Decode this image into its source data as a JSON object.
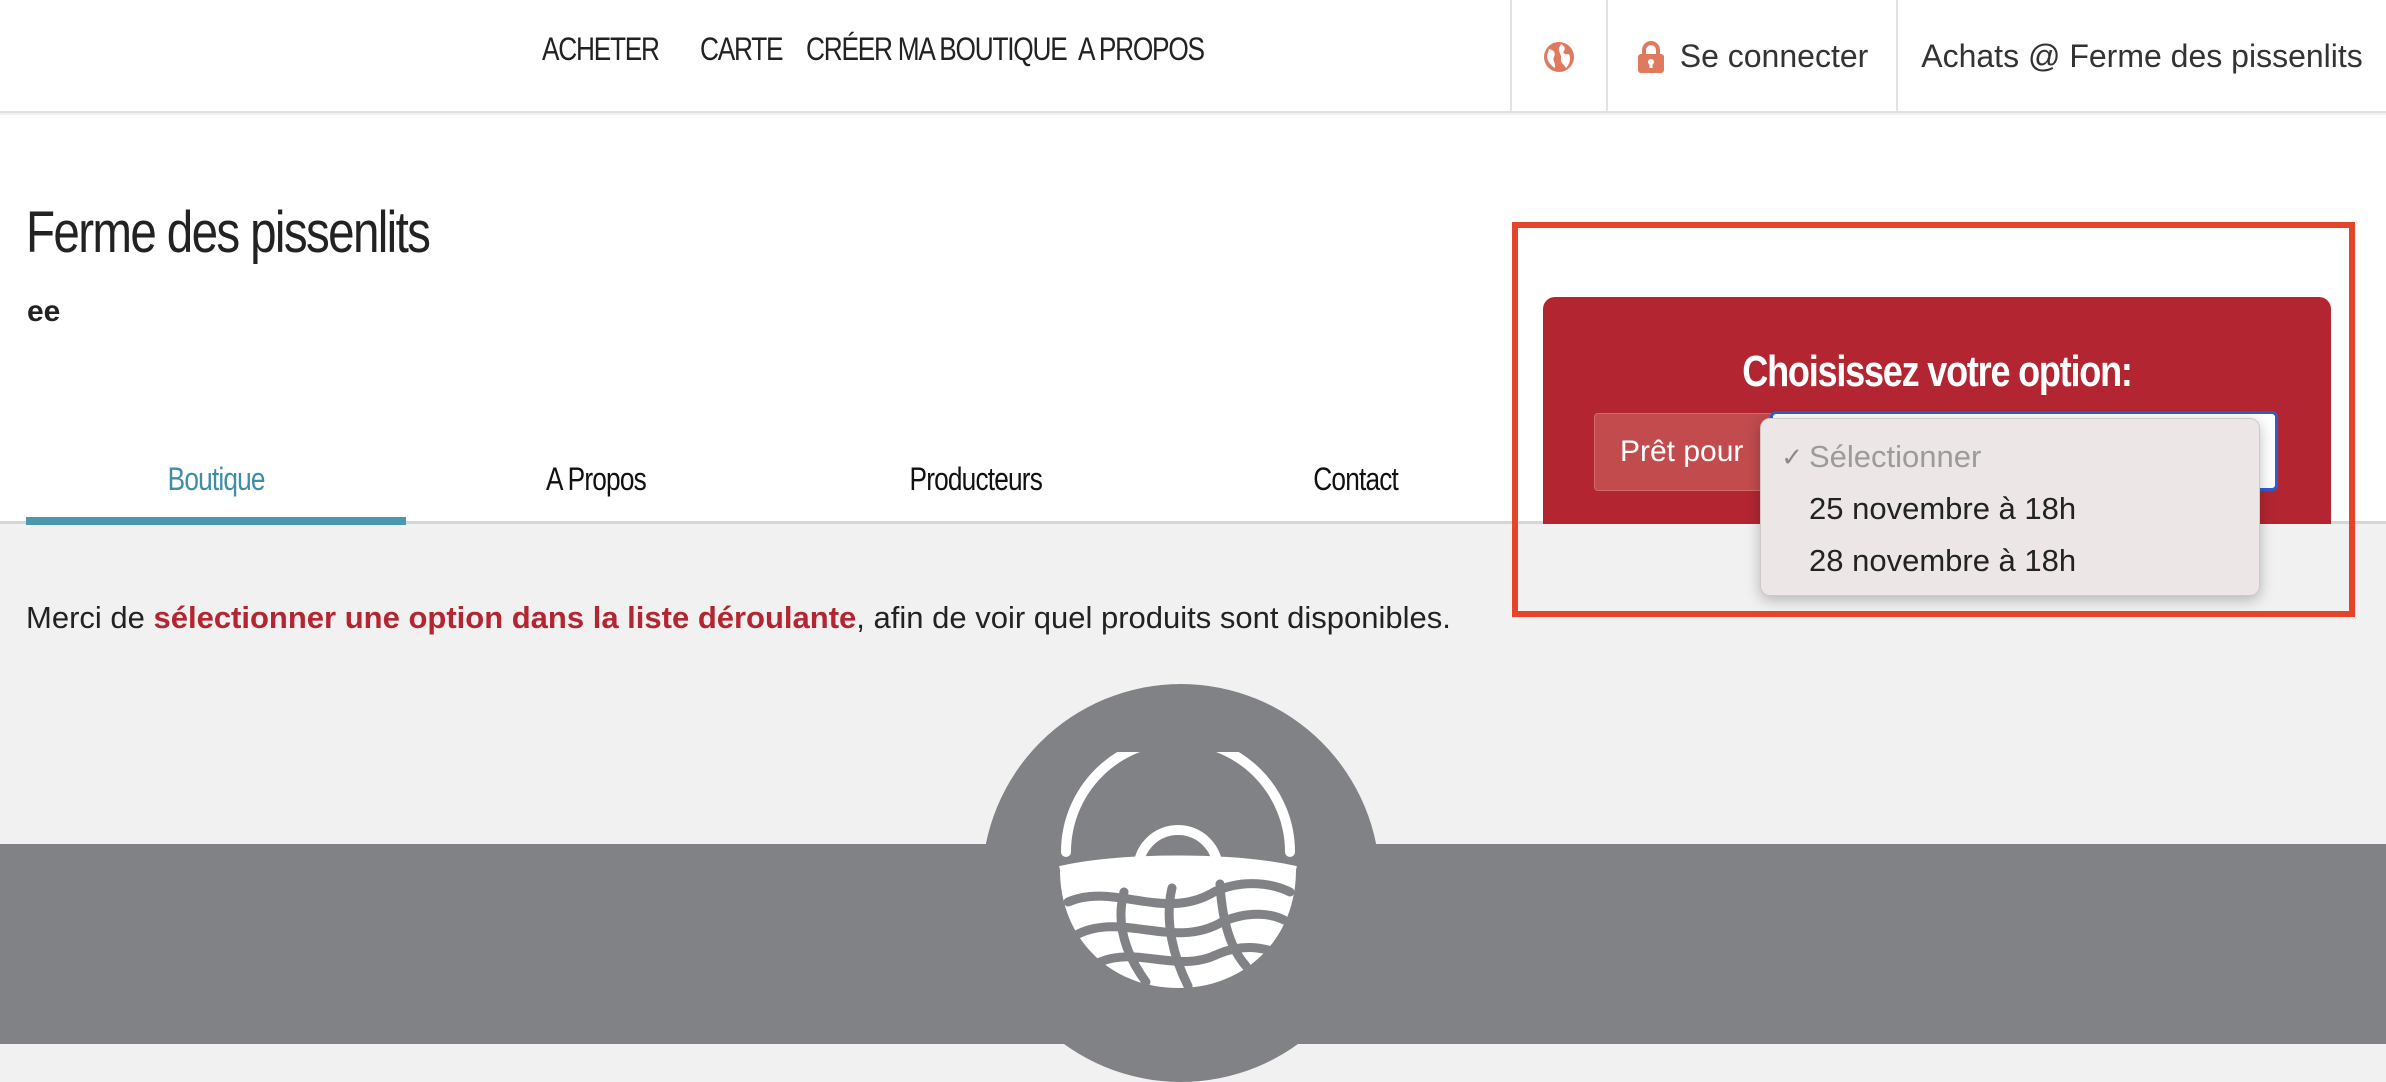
{
  "nav": {
    "links": [
      "ACHETER",
      "CARTE",
      "CRÉER MA BOUTIQUE",
      "A PROPOS"
    ],
    "login_label": "Se connecter",
    "shop_label": "Achats @ Ferme des pissenlits",
    "accent_color": "#e07a5f"
  },
  "shop": {
    "title": "Ferme des pissenlits",
    "subtitle": "ee"
  },
  "tabs": [
    {
      "label": "Boutique",
      "active": true
    },
    {
      "label": "A Propos",
      "active": false
    },
    {
      "label": "Producteurs",
      "active": false
    },
    {
      "label": "Contact",
      "active": false
    }
  ],
  "option_panel": {
    "title": "Choisissez votre option:",
    "ready_label": "Prêt pour",
    "panel_color": "#b32631"
  },
  "dropdown": {
    "check_mark": "✓",
    "options": [
      "Sélectionner",
      "25 novembre à 18h",
      "28 novembre à 18h"
    ],
    "selected_index": 0
  },
  "message": {
    "prefix": "Merci de ",
    "highlight": "sélectionner une option dans la liste déroulante",
    "suffix": ", afin de voir quel produits sont disponibles."
  },
  "icons": {
    "globe": "globe-icon",
    "lock": "lock-icon",
    "basket": "basket-icon"
  }
}
